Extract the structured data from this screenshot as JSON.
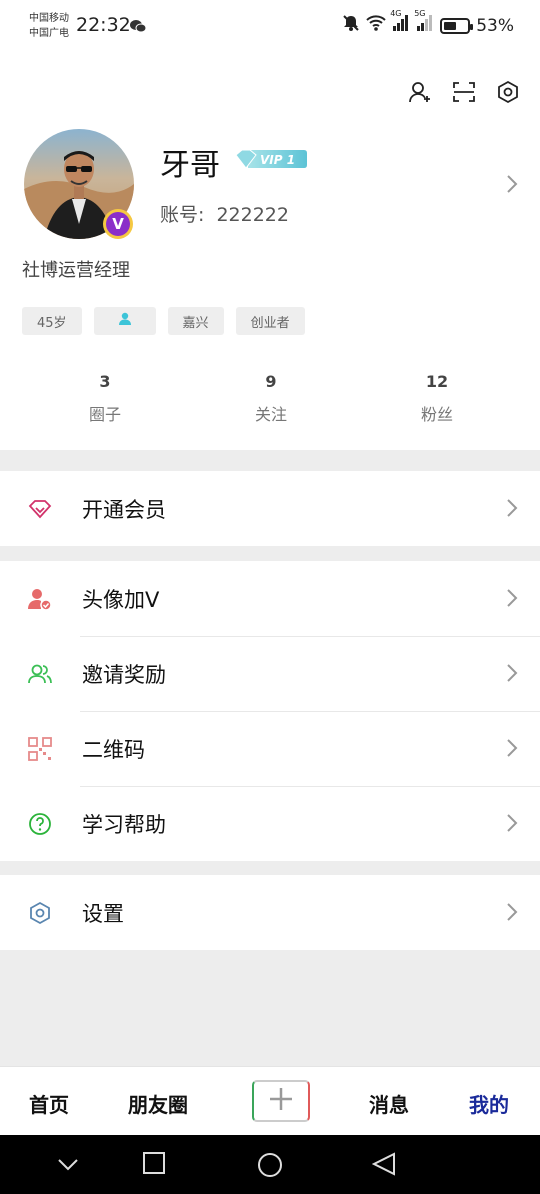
{
  "status_bar": {
    "carrier_1": "中国移动",
    "carrier_2": "中国广电",
    "time": "22:32",
    "net_1": "4G",
    "net_2": "5G",
    "battery": "53%",
    "battery_level": 0.53
  },
  "profile": {
    "name": "牙哥",
    "vip_badge": "VIP 1",
    "account_label": "账号:",
    "account_value": "222222",
    "job_title": "社博运营经理",
    "tags": {
      "age": "45岁",
      "city": "嘉兴",
      "role": "创业者"
    },
    "stats": [
      {
        "value": "3",
        "label": "圈子"
      },
      {
        "value": "9",
        "label": "关注"
      },
      {
        "value": "12",
        "label": "粉丝"
      }
    ]
  },
  "menu": {
    "membership": "开通会员",
    "avatar_v": "头像加V",
    "invite": "邀请奖励",
    "qrcode": "二维码",
    "help": "学习帮助",
    "settings": "设置"
  },
  "bottom_nav": {
    "home": "首页",
    "moments": "朋友圈",
    "messages": "消息",
    "mine": "我的"
  },
  "colors": {
    "active_nav": "#1a2a9a",
    "membership_icon": "#d2336b",
    "avatar_v_icon": "#e66a6a",
    "invite_icon": "#3bbf55",
    "qrcode_icon": "#e68a8a",
    "help_icon": "#2bb33a",
    "settings_icon": "#5a86b0"
  }
}
